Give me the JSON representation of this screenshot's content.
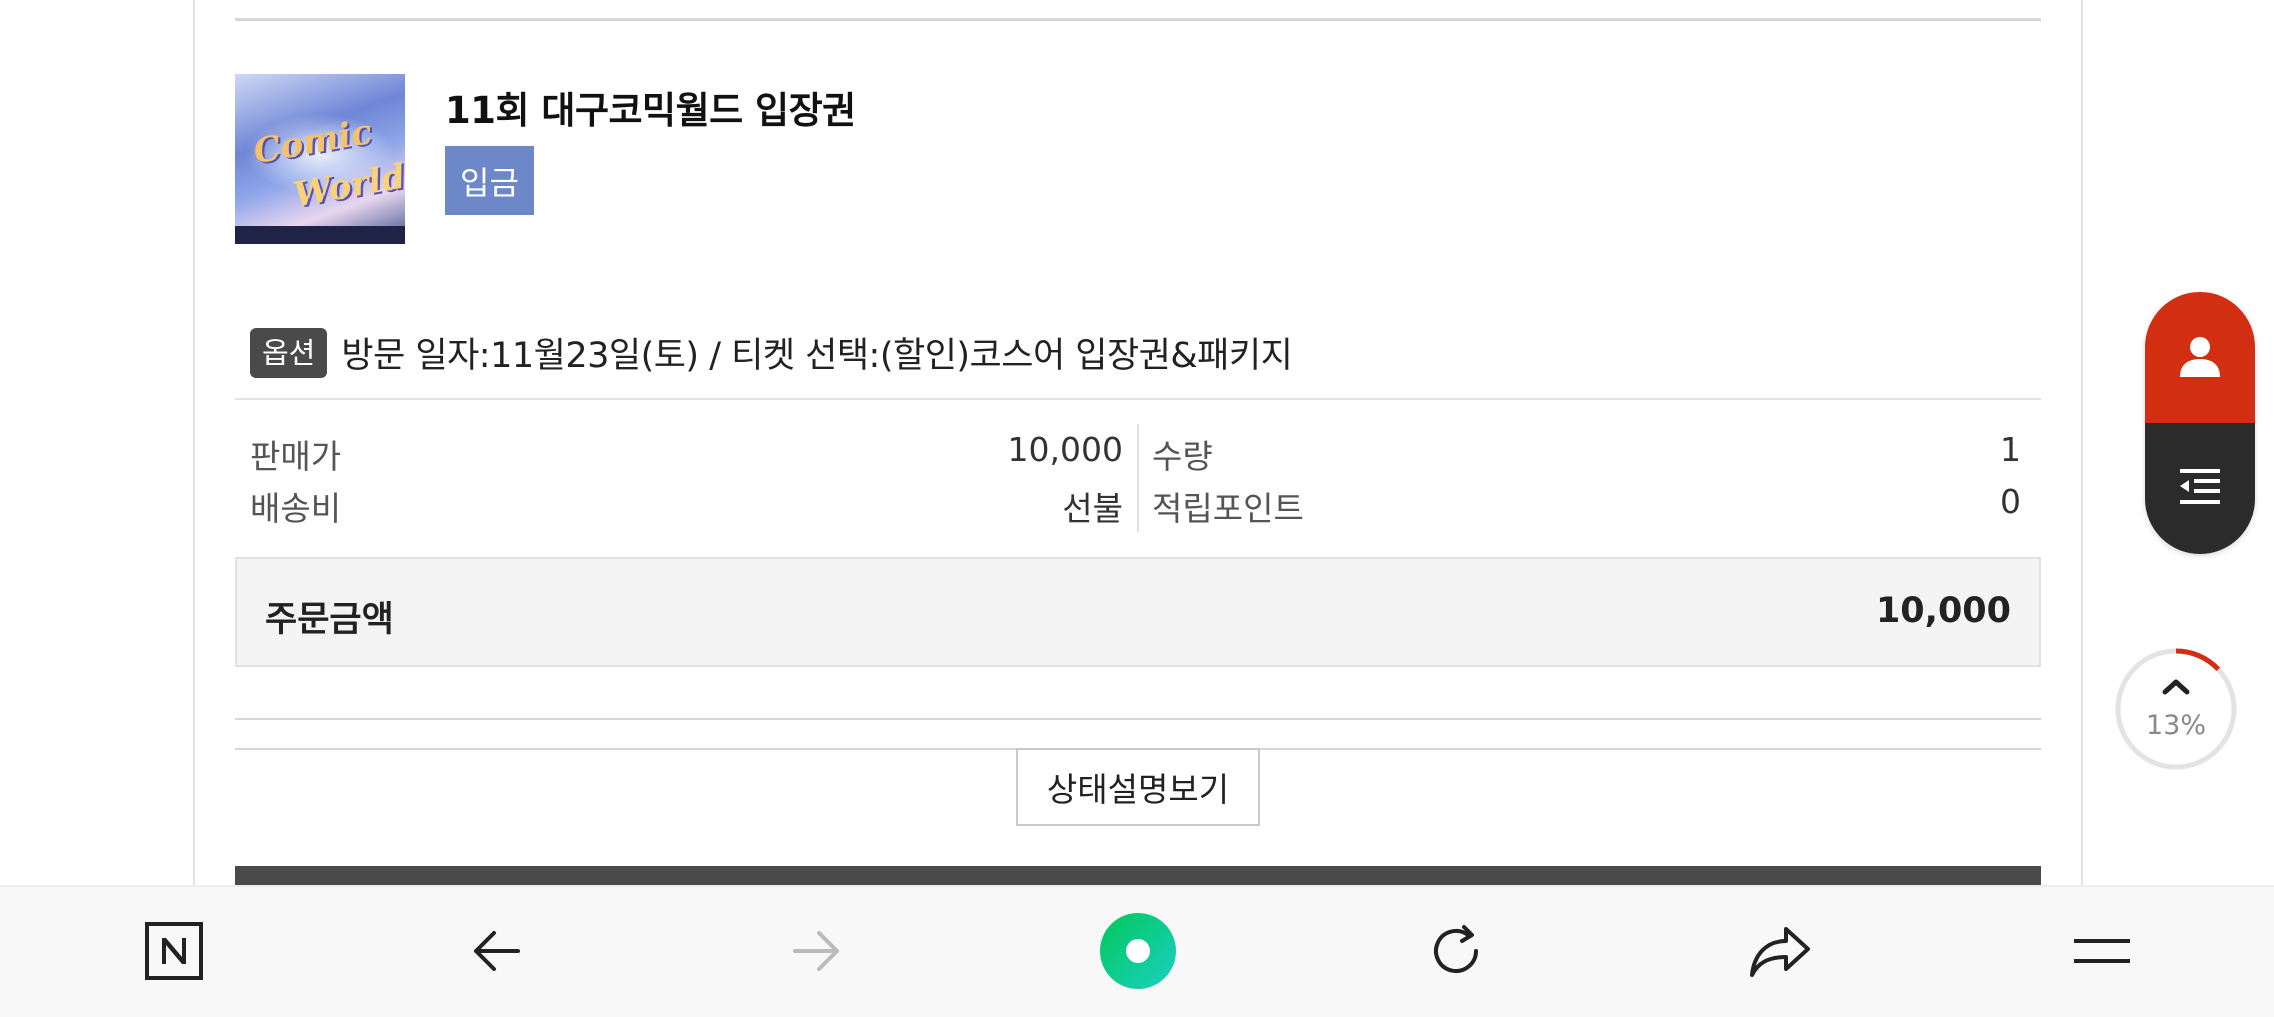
{
  "product": {
    "title": "11회 대구코믹월드 입장권",
    "status": "입금",
    "thumb_text_1": "Comic",
    "thumb_text_2": "World"
  },
  "option": {
    "tag": "옵션",
    "text": "방문 일자:11월23일(토) / 티켓 선택:(할인)코스어 입장권&패키지"
  },
  "details": {
    "price_label": "판매가",
    "price_value": "10,000",
    "quantity_label": "수량",
    "quantity_value": "1",
    "shipping_label": "배송비",
    "shipping_value": "선불",
    "points_label": "적립포인트",
    "points_value": "0"
  },
  "total": {
    "label": "주문금액",
    "value": "10,000"
  },
  "status_button": "상태설명보기",
  "scroll": {
    "percent_label": "13%",
    "percent": 13
  },
  "side_widget": {
    "top_icon": "user-icon",
    "bottom_icon": "list-collapse-icon",
    "top_color": "#d22f12",
    "bottom_color": "#2b2b2b"
  },
  "bottom_nav": {
    "items": [
      "naver-home-icon",
      "back-arrow-icon",
      "forward-arrow-icon",
      "green-dot-icon",
      "refresh-icon",
      "share-icon",
      "menu-icon"
    ],
    "accent": "#03c75a"
  }
}
